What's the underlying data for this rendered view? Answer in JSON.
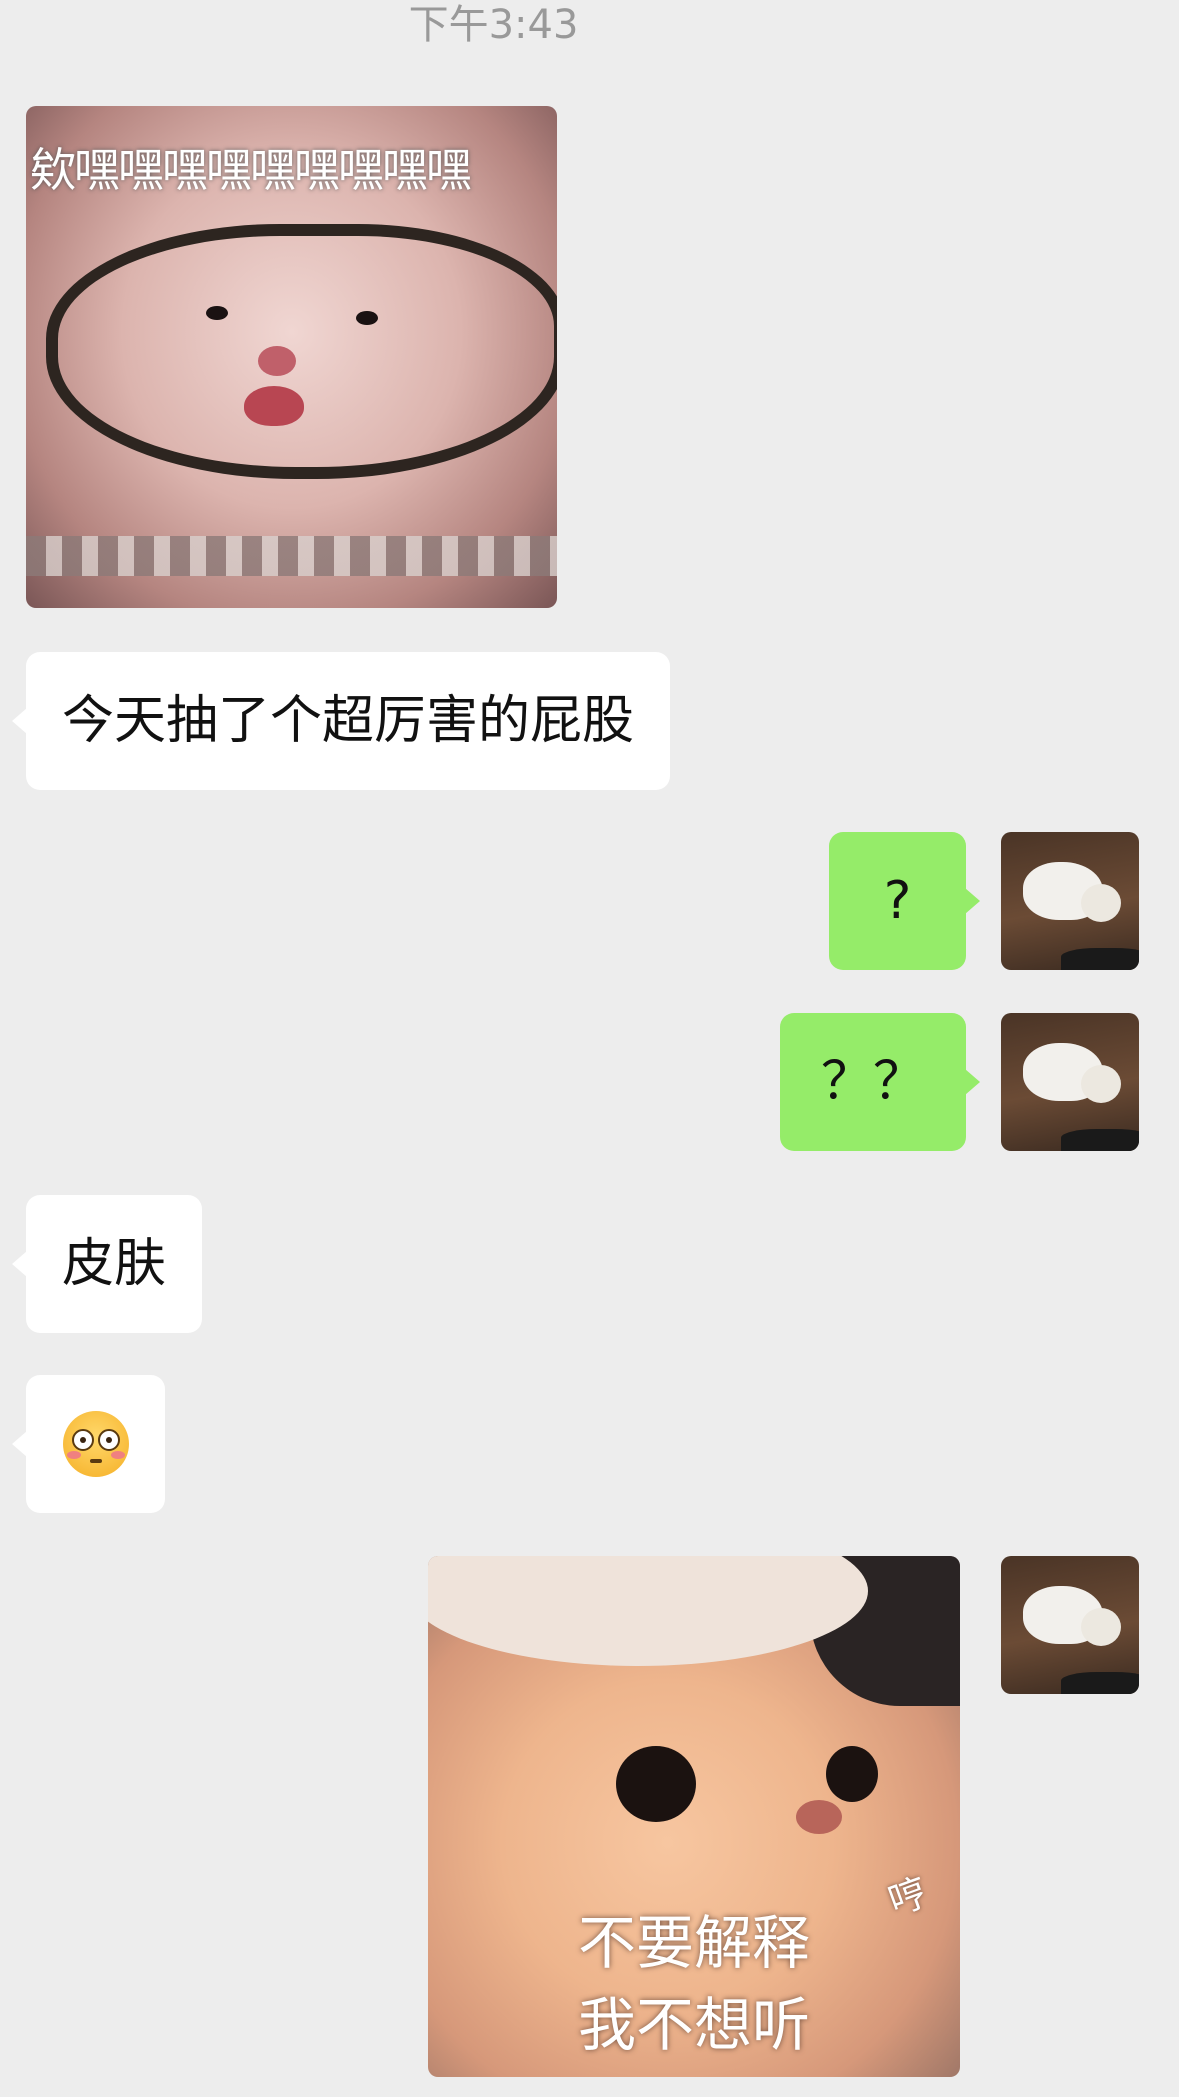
{
  "status": {
    "timestamp": "下午3:43"
  },
  "messages": [
    {
      "id": "m1",
      "side": "left",
      "type": "sticker",
      "caption": "欸嘿嘿嘿嘿嘿嘿嘿嘿嘿"
    },
    {
      "id": "m2",
      "side": "left",
      "type": "text",
      "text": "今天抽了个超厉害的屁股"
    },
    {
      "id": "m3",
      "side": "right",
      "type": "text",
      "text": "?"
    },
    {
      "id": "m4",
      "side": "right",
      "type": "text",
      "text": "？？"
    },
    {
      "id": "m5",
      "side": "left",
      "type": "text",
      "text": "皮肤"
    },
    {
      "id": "m6",
      "side": "left",
      "type": "emoji",
      "emoji": "flushed-face-icon"
    },
    {
      "id": "m7",
      "side": "right",
      "type": "sticker",
      "caption_line1": "不要解释",
      "caption_line2": "我不想听",
      "side_text": "哼"
    }
  ],
  "colors": {
    "background": "#ededed",
    "incoming_bubble": "#ffffff",
    "outgoing_bubble": "#95ec69",
    "timestamp_text": "#999999"
  }
}
